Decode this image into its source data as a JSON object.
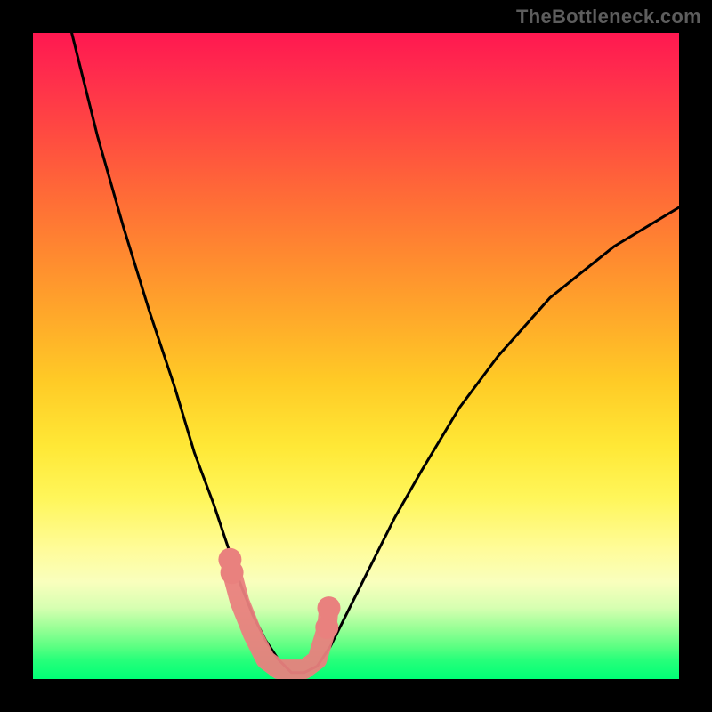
{
  "watermark": "TheBottleneck.com",
  "chart_data": {
    "type": "line",
    "title": "",
    "xlabel": "",
    "ylabel": "",
    "xlim": [
      0,
      100
    ],
    "ylim": [
      0,
      100
    ],
    "grid": false,
    "legend": false,
    "background_gradient": {
      "top_color": "#ff1850",
      "mid_color": "#ffe836",
      "bottom_color": "#00ff76"
    },
    "series": [
      {
        "name": "bottleneck-curve",
        "color": "#000000",
        "type": "line",
        "x": [
          6,
          10,
          14,
          18,
          22,
          25,
          28,
          30,
          32,
          34,
          36,
          38,
          40,
          42,
          44,
          46,
          48,
          52,
          56,
          60,
          66,
          72,
          80,
          90,
          100
        ],
        "y": [
          100,
          84,
          70,
          57,
          45,
          35,
          27,
          21,
          15,
          10,
          6,
          3,
          1,
          1,
          2,
          5,
          9,
          17,
          25,
          32,
          42,
          50,
          59,
          67,
          73
        ]
      },
      {
        "name": "selected-band",
        "color": "#e9817e",
        "type": "scatter",
        "x": [
          30.5,
          30.8,
          32,
          34,
          36,
          38,
          40,
          42,
          44,
          45.5,
          45.8
        ],
        "y": [
          18.5,
          16.5,
          12,
          7,
          3,
          1.5,
          1.5,
          1.5,
          3,
          8,
          11
        ]
      }
    ],
    "colors": {
      "curve": "#000000",
      "markers": "#e9817e",
      "frame": "#000000"
    }
  }
}
